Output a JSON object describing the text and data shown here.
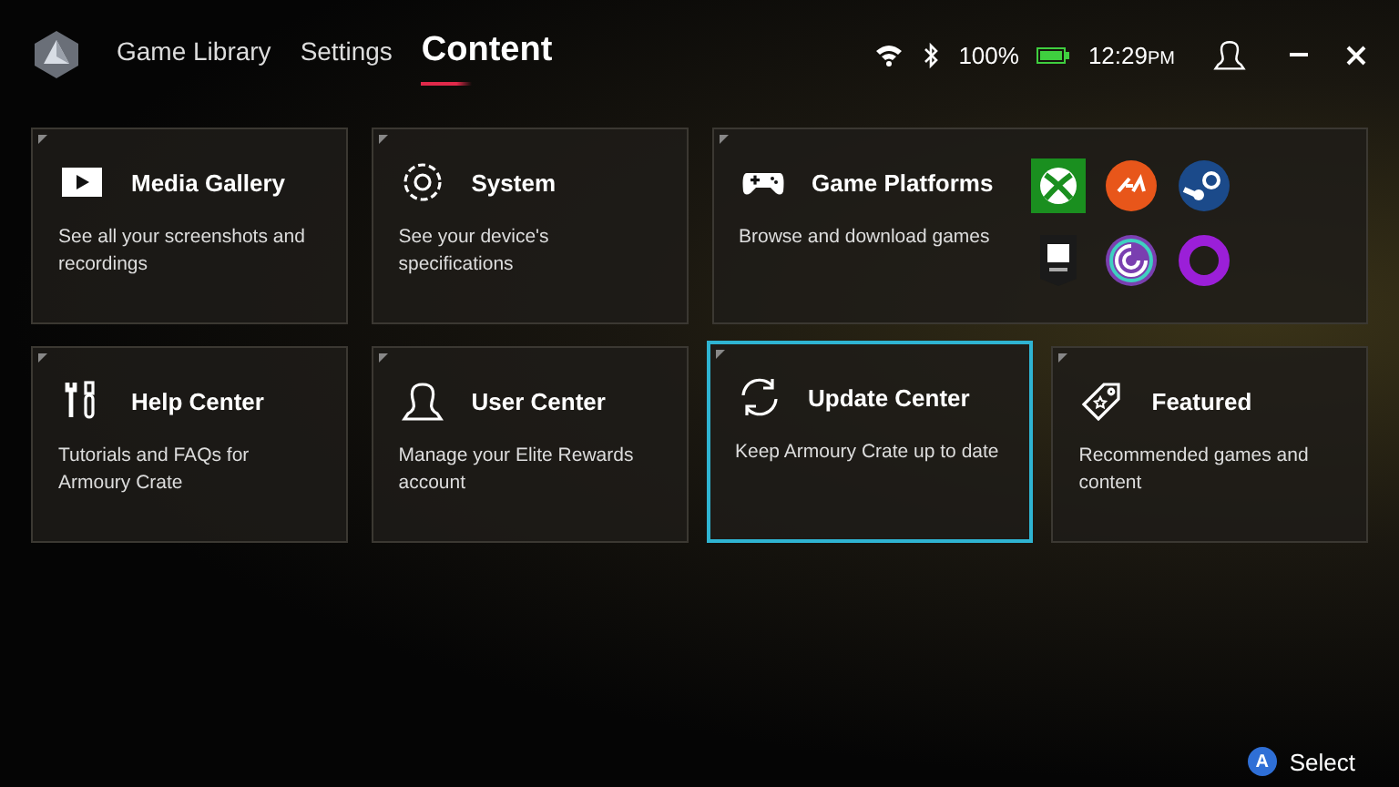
{
  "header": {
    "tabs": [
      {
        "label": "Game Library",
        "selected": false
      },
      {
        "label": "Settings",
        "selected": false
      },
      {
        "label": "Content",
        "selected": true
      }
    ],
    "status": {
      "battery_text": "100%",
      "time": "12:29",
      "period": "PM"
    }
  },
  "cards": [
    {
      "kind": "media",
      "title": "Media Gallery",
      "description": "See all your screenshots and recordings",
      "selected": false
    },
    {
      "kind": "system",
      "title": "System",
      "description": "See your device's specifications",
      "selected": false
    },
    {
      "kind": "platforms",
      "title": "Game Platforms",
      "description": "Browse and download games",
      "selected": false,
      "platforms": [
        {
          "kind": "xbox"
        },
        {
          "kind": "ea"
        },
        {
          "kind": "steam"
        },
        {
          "kind": "epic"
        },
        {
          "kind": "ubisoft"
        },
        {
          "kind": "gog"
        }
      ]
    },
    {
      "kind": "help",
      "title": "Help Center",
      "description": "Tutorials and FAQs for Armoury Crate",
      "selected": false
    },
    {
      "kind": "user",
      "title": "User Center",
      "description": "Manage your Elite Rewards account",
      "selected": false
    },
    {
      "kind": "update",
      "title": "Update Center",
      "description": "Keep Armoury Crate up to date",
      "selected": true
    },
    {
      "kind": "featured",
      "title": "Featured",
      "description": "Recommended games and content",
      "selected": false
    }
  ],
  "footer": {
    "key": "A",
    "label": "Select"
  }
}
